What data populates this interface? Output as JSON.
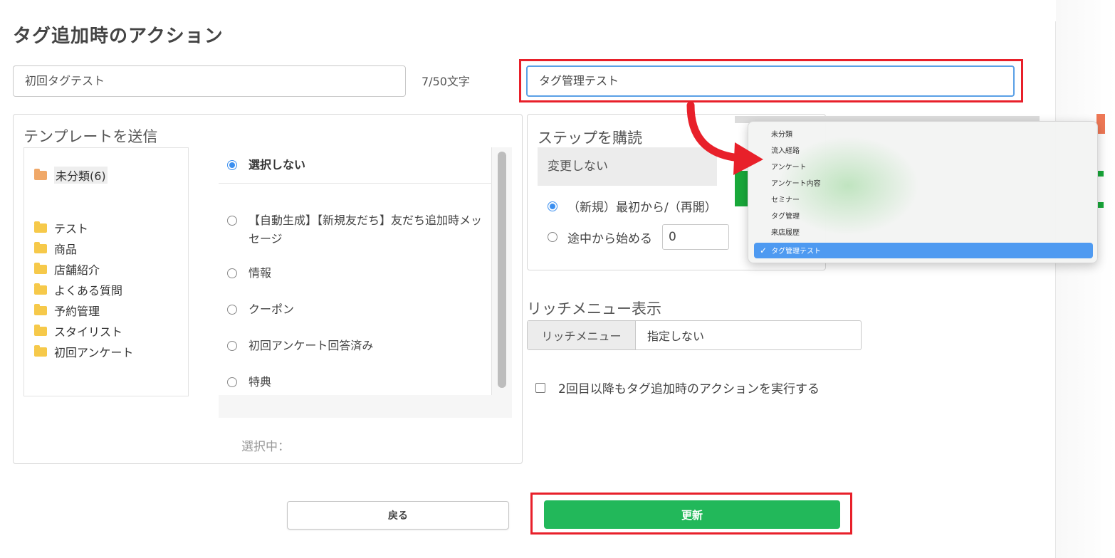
{
  "page_title": "タグ追加時のアクション",
  "tag_name_input": {
    "value": "初回タグテスト"
  },
  "char_count": "7/50文字",
  "folder_select": {
    "value": "タグ管理テスト"
  },
  "template_section": {
    "heading": "テンプレートを送信",
    "folders": [
      {
        "label": "未分類(6)",
        "icon": "folder-open-icon",
        "selected": true
      },
      {
        "label": "テスト",
        "icon": "folder-icon"
      },
      {
        "label": "商品",
        "icon": "folder-icon"
      },
      {
        "label": "店舗紹介",
        "icon": "folder-icon"
      },
      {
        "label": "よくある質問",
        "icon": "folder-icon"
      },
      {
        "label": "予約管理",
        "icon": "folder-icon"
      },
      {
        "label": "スタイリスト",
        "icon": "folder-icon"
      },
      {
        "label": "初回アンケート",
        "icon": "folder-icon"
      }
    ],
    "options": [
      {
        "label": "選択しない",
        "checked": true
      },
      {
        "label": "【自動生成】【新規友だち】友だち追加時メッセージ",
        "checked": false
      },
      {
        "label": "情報",
        "checked": false
      },
      {
        "label": "クーポン",
        "checked": false
      },
      {
        "label": "初回アンケート回答済み",
        "checked": false
      },
      {
        "label": "特典",
        "checked": false
      }
    ],
    "selected_label": "選択中："
  },
  "step_section": {
    "heading": "ステップを購読",
    "no_change": "変更しない",
    "radio_restart": "（新規）最初から/（再開）",
    "radio_middle": "途中から始める",
    "middle_value": "0"
  },
  "rich_menu": {
    "heading": "リッチメニュー表示",
    "label": "リッチメニュー",
    "value": "指定しない"
  },
  "repeat_action": {
    "label": "2回目以降もタグ追加時のアクションを実行する",
    "checked": false
  },
  "buttons": {
    "back": "戻る",
    "update": "更新"
  },
  "dropdown": {
    "items": [
      "未分類",
      "流入経路",
      "アンケート",
      "アンケート内容",
      "セミナー",
      "タグ管理",
      "来店履歴",
      "タグ管理テスト"
    ],
    "selected": "タグ管理テスト",
    "check_icon": "checkmark-icon"
  },
  "colors": {
    "accent": "#3b8ff0",
    "update_button": "#22b85a",
    "highlight": "#e8202a",
    "dropdown_selected": "#4e9af1"
  }
}
